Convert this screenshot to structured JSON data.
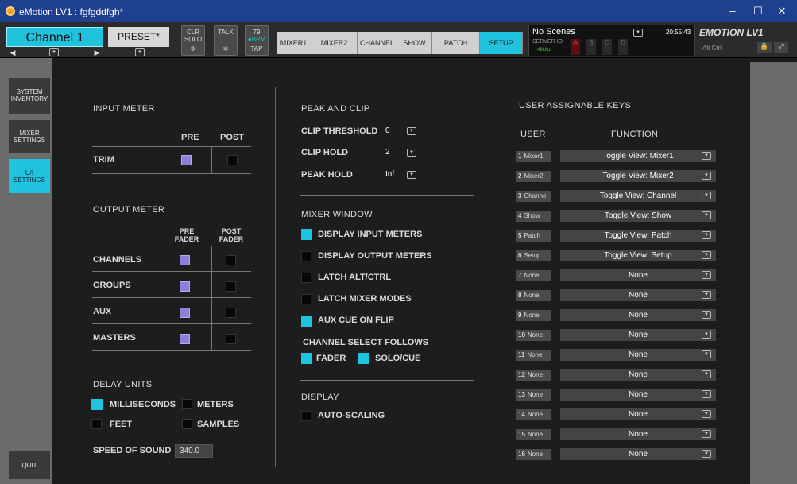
{
  "window": {
    "title": "eMotion LV1 : fgfgddfgh*"
  },
  "topbar": {
    "channel": "Channel 1",
    "preset": "PRESET*",
    "clr_solo_1": "CLR",
    "clr_solo_2": "SOLO",
    "talk": "TALK",
    "bpm_value": "79",
    "bpm_label": "BPM",
    "tap": "TAP",
    "tabs": [
      "MIXER1",
      "MIXER2",
      "CHANNEL",
      "SHOW",
      "PATCH",
      "SETUP"
    ],
    "scenes": "No Scenes",
    "clock": "20:55:43",
    "server": "SERVER IO",
    "rate": "48kHz",
    "abcd": [
      "A",
      "B",
      "C",
      "D"
    ],
    "brand": "EMOTION LV1",
    "mods": "Alt  Ctrl"
  },
  "sidebar": {
    "system": [
      "SYSTEM",
      "INVENTORY"
    ],
    "mixer": [
      "MIXER",
      "SETTINGS"
    ],
    "ui": [
      "U/I",
      "SETTINGS"
    ],
    "quit": "QUIT"
  },
  "input_meter": {
    "title": "INPUT METER",
    "pre": "PRE",
    "post": "POST",
    "trim": "TRIM"
  },
  "output_meter": {
    "title": "OUTPUT METER",
    "pre1": "PRE",
    "pre2": "FADER",
    "post1": "POST",
    "post2": "FADER",
    "rows": [
      "CHANNELS",
      "GROUPS",
      "AUX",
      "MASTERS"
    ]
  },
  "delay": {
    "title": "DELAY UNITS",
    "ms": "MILLISECONDS",
    "meters": "METERS",
    "feet": "FEET",
    "samples": "SAMPLES",
    "sos_label": "SPEED OF SOUND",
    "sos_value": "340.0"
  },
  "peak": {
    "title": "PEAK AND CLIP",
    "clip_threshold": "CLIP THRESHOLD",
    "clip_threshold_v": "0",
    "clip_hold": "CLIP HOLD",
    "clip_hold_v": "2",
    "peak_hold": "PEAK HOLD",
    "peak_hold_v": "Inf"
  },
  "mixer_window": {
    "title": "MIXER WINDOW",
    "items": [
      "DISPLAY INPUT METERS",
      "DISPLAY OUTPUT METERS",
      "LATCH ALT/CTRL",
      "LATCH MIXER MODES",
      "AUX CUE ON FLIP"
    ],
    "csf": "CHANNEL SELECT FOLLOWS",
    "fader": "FADER",
    "solocue": "SOLO/CUE"
  },
  "display": {
    "title": "DISPLAY",
    "autoscale": "AUTO-SCALING"
  },
  "uak": {
    "title": "USER ASSIGNABLE KEYS",
    "user": "USER",
    "function": "FUNCTION",
    "keys": [
      {
        "n": "1",
        "k": "Mixer1",
        "f": "Toggle View: Mixer1"
      },
      {
        "n": "2",
        "k": "Mixer2",
        "f": "Toggle View: Mixer2"
      },
      {
        "n": "3",
        "k": "Channel",
        "f": "Toggle View: Channel"
      },
      {
        "n": "4",
        "k": "Show",
        "f": "Toggle View: Show"
      },
      {
        "n": "5",
        "k": "Patch",
        "f": "Toggle View: Patch"
      },
      {
        "n": "6",
        "k": "Setup",
        "f": "Toggle View: Setup"
      },
      {
        "n": "7",
        "k": "None",
        "f": "None"
      },
      {
        "n": "8",
        "k": "None",
        "f": "None"
      },
      {
        "n": "9",
        "k": "None",
        "f": "None"
      },
      {
        "n": "10",
        "k": "None",
        "f": "None"
      },
      {
        "n": "11",
        "k": "None",
        "f": "None"
      },
      {
        "n": "12",
        "k": "None",
        "f": "None"
      },
      {
        "n": "13",
        "k": "None",
        "f": "None"
      },
      {
        "n": "14",
        "k": "None",
        "f": "None"
      },
      {
        "n": "15",
        "k": "None",
        "f": "None"
      },
      {
        "n": "16",
        "k": "None",
        "f": "None"
      }
    ]
  }
}
